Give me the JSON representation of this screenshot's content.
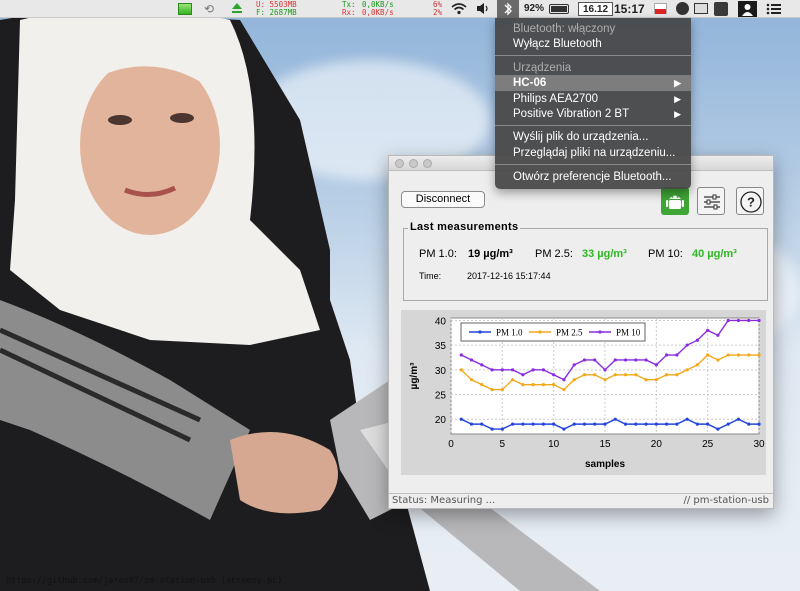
{
  "menubar": {
    "mem_used": "U: 5503MB",
    "mem_free": "F: 2687MB",
    "tx_label": "Tx:",
    "tx_value": "0,0KB/s",
    "rx_label": "Rx:",
    "rx_value": "0,0KB/s",
    "cpu_top": "6%",
    "cpu_bottom": "2%",
    "battery": "92%",
    "date": "16.12",
    "time": "15:17"
  },
  "bluetooth_menu": {
    "status": "Bluetooth: włączony",
    "turn_off": "Wyłącz Bluetooth",
    "devices_header": "Urządzenia",
    "devices": [
      "HC-06",
      "Philips AEA2700",
      "Positive Vibration 2 BT"
    ],
    "send_file": "Wyślij plik do urządzenia...",
    "browse_files": "Przeglądaj pliki na urządzeniu...",
    "preferences": "Otwórz preferencje Bluetooth..."
  },
  "app": {
    "disconnect_label": "Disconnect",
    "panel_title": "Last measurements",
    "pm1_label": "PM 1.0:",
    "pm1_value": "19 µg/m³",
    "pm25_label": "PM 2.5:",
    "pm25_value": "33 µg/m³",
    "pm10_label": "PM 10:",
    "pm10_value": "40 µg/m³",
    "time_label": "Time:",
    "time_value": "2017-12-16 15:17:44",
    "status": "Status: Measuring ...",
    "app_name": "// pm-station-usb"
  },
  "colors": {
    "pm1": "#2244dd",
    "pm25": "#f3a81a",
    "pm10": "#8a2be2",
    "value_green": "#2fb824",
    "android_green": "#3fa535"
  },
  "chart_data": {
    "type": "line",
    "xlabel": "samples",
    "ylabel": "µg/m³",
    "xlim": [
      0,
      30
    ],
    "ylim": [
      17,
      40.5
    ],
    "xticks": [
      0,
      5,
      10,
      15,
      20,
      25,
      30
    ],
    "yticks": [
      20,
      25,
      30,
      35,
      40
    ],
    "legend": "top-left",
    "series": [
      {
        "name": "PM 1.0",
        "color": "#2244dd",
        "x": [
          1,
          2,
          3,
          4,
          5,
          6,
          7,
          8,
          9,
          10,
          11,
          12,
          13,
          14,
          15,
          16,
          17,
          18,
          19,
          20,
          21,
          22,
          23,
          24,
          25,
          26,
          27,
          28,
          29,
          30
        ],
        "y": [
          20,
          19,
          19,
          18,
          18,
          19,
          19,
          19,
          19,
          19,
          18,
          19,
          19,
          19,
          19,
          20,
          19,
          19,
          19,
          19,
          19,
          19,
          20,
          19,
          19,
          18,
          19,
          20,
          19,
          19
        ]
      },
      {
        "name": "PM 2.5",
        "color": "#f3a81a",
        "x": [
          1,
          2,
          3,
          4,
          5,
          6,
          7,
          8,
          9,
          10,
          11,
          12,
          13,
          14,
          15,
          16,
          17,
          18,
          19,
          20,
          21,
          22,
          23,
          24,
          25,
          26,
          27,
          28,
          29,
          30
        ],
        "y": [
          30,
          28,
          27,
          26,
          26,
          28,
          27,
          27,
          27,
          27,
          26,
          28,
          29,
          29,
          28,
          29,
          29,
          29,
          28,
          28,
          29,
          29,
          30,
          31,
          33,
          32,
          33,
          33,
          33,
          33
        ]
      },
      {
        "name": "PM 10",
        "color": "#8a2be2",
        "x": [
          1,
          2,
          3,
          4,
          5,
          6,
          7,
          8,
          9,
          10,
          11,
          12,
          13,
          14,
          15,
          16,
          17,
          18,
          19,
          20,
          21,
          22,
          23,
          24,
          25,
          26,
          27,
          28,
          29,
          30
        ],
        "y": [
          33,
          32,
          31,
          30,
          30,
          30,
          29,
          30,
          30,
          29,
          28,
          31,
          32,
          32,
          30,
          32,
          32,
          32,
          32,
          31,
          33,
          33,
          35,
          36,
          38,
          37,
          40,
          40,
          40,
          40
        ]
      }
    ]
  },
  "watermark_url": "https://github.com/jaros87/pm-station-usb (screeny-pc)"
}
